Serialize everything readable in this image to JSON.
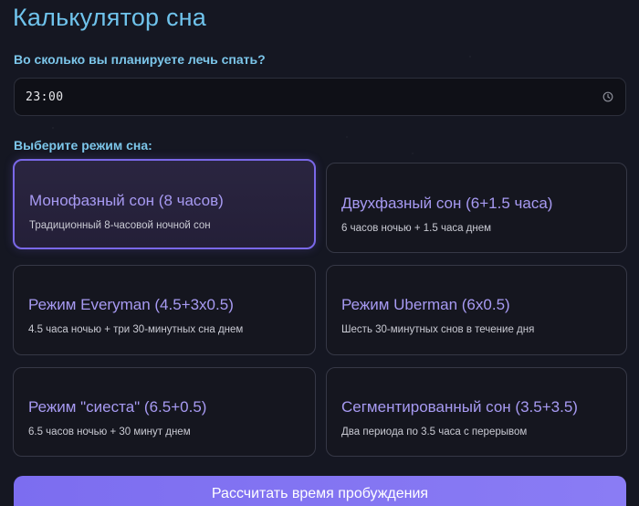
{
  "header": {
    "title": "Калькулятор сна"
  },
  "bedtime": {
    "label": "Во сколько вы планируете лечь спать?",
    "value": "23:00",
    "icon": "clock-icon"
  },
  "mode_section": {
    "label": "Выберите режим сна:",
    "selected_index": 0,
    "modes": [
      {
        "title": "Монофазный сон (8 часов)",
        "description": "Традиционный 8-часовой ночной сон"
      },
      {
        "title": "Двухфазный сон (6+1.5 часа)",
        "description": "6 часов ночью + 1.5 часа днем"
      },
      {
        "title": "Режим Everyman (4.5+3x0.5)",
        "description": "4.5 часа ночью + три 30-минутных сна днем"
      },
      {
        "title": "Режим Uberman (6x0.5)",
        "description": "Шесть 30-минутных снов в течение дня"
      },
      {
        "title": "Режим \"сиеста\" (6.5+0.5)",
        "description": "6.5 часов ночью + 30 минут днем"
      },
      {
        "title": "Сегментированный сон (3.5+3.5)",
        "description": "Два периода по 3.5 часа с перерывом"
      }
    ]
  },
  "actions": {
    "calculate_label": "Рассчитать время пробуждения"
  },
  "colors": {
    "accent": "#7c6df0",
    "heading": "#6fc3ec",
    "card_title": "#a79af2",
    "background": "#151722"
  }
}
